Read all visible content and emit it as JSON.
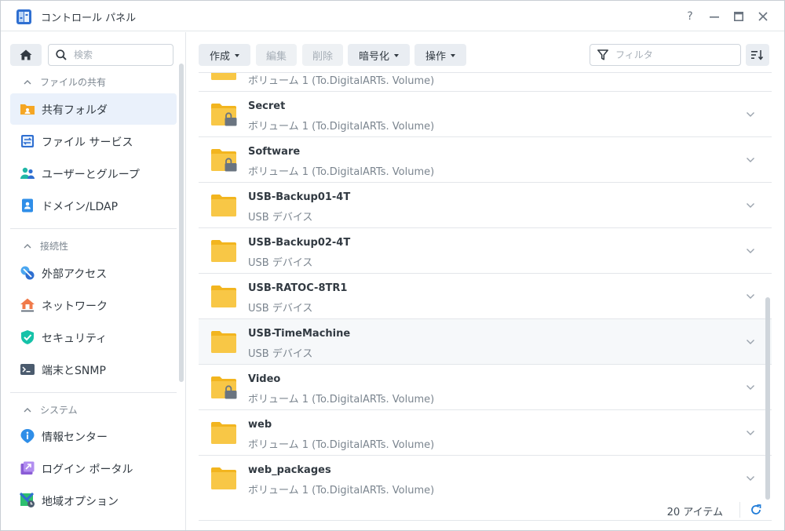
{
  "window": {
    "title": "コントロール パネル",
    "buttons": [
      "help",
      "minimize",
      "maximize",
      "close"
    ],
    "help_label": "?"
  },
  "sidebar": {
    "search_placeholder": "検索",
    "sections": [
      {
        "title": "ファイルの共有",
        "items": [
          {
            "label": "共有フォルダ",
            "icon": "shared-folder-icon",
            "active": true
          },
          {
            "label": "ファイル サービス",
            "icon": "file-services-icon"
          },
          {
            "label": "ユーザーとグループ",
            "icon": "users-groups-icon"
          },
          {
            "label": "ドメイン/LDAP",
            "icon": "domain-ldap-icon"
          }
        ]
      },
      {
        "title": "接続性",
        "items": [
          {
            "label": "外部アクセス",
            "icon": "external-access-icon"
          },
          {
            "label": "ネットワーク",
            "icon": "network-icon"
          },
          {
            "label": "セキュリティ",
            "icon": "security-icon"
          },
          {
            "label": "端末とSNMP",
            "icon": "terminal-snmp-icon"
          }
        ]
      },
      {
        "title": "システム",
        "items": [
          {
            "label": "情報センター",
            "icon": "info-center-icon"
          },
          {
            "label": "ログイン ポータル",
            "icon": "login-portal-icon"
          },
          {
            "label": "地域オプション",
            "icon": "regional-options-icon"
          }
        ]
      }
    ]
  },
  "toolbar": {
    "create": "作成",
    "edit": "編集",
    "delete": "削除",
    "encryption": "暗号化",
    "action": "操作",
    "filter_placeholder": "フィルタ"
  },
  "folders": [
    {
      "name": "",
      "sub": "ボリューム 1 (To.DigitalARTs. Volume)",
      "locked": false
    },
    {
      "name": "Secret",
      "sub": "ボリューム 1 (To.DigitalARTs. Volume)",
      "locked": true
    },
    {
      "name": "Software",
      "sub": "ボリューム 1 (To.DigitalARTs. Volume)",
      "locked": true
    },
    {
      "name": "USB-Backup01-4T",
      "sub": "USB デバイス",
      "locked": false
    },
    {
      "name": "USB-Backup02-4T",
      "sub": "USB デバイス",
      "locked": false
    },
    {
      "name": "USB-RATOC-8TR1",
      "sub": "USB デバイス",
      "locked": false
    },
    {
      "name": "USB-TimeMachine",
      "sub": "USB デバイス",
      "locked": false,
      "hover": true
    },
    {
      "name": "Video",
      "sub": "ボリューム 1 (To.DigitalARTs. Volume)",
      "locked": true
    },
    {
      "name": "web",
      "sub": "ボリューム 1 (To.DigitalARTs. Volume)",
      "locked": false
    },
    {
      "name": "web_packages",
      "sub": "ボリューム 1 (To.DigitalARTs. Volume)",
      "locked": false
    }
  ],
  "footer": {
    "count": "20 アイテム"
  },
  "colors": {
    "accent": "#1f7bd8",
    "folder": "#f8c746",
    "folder_dark": "#f2b51f",
    "active_nav": "#eaf1fb"
  }
}
